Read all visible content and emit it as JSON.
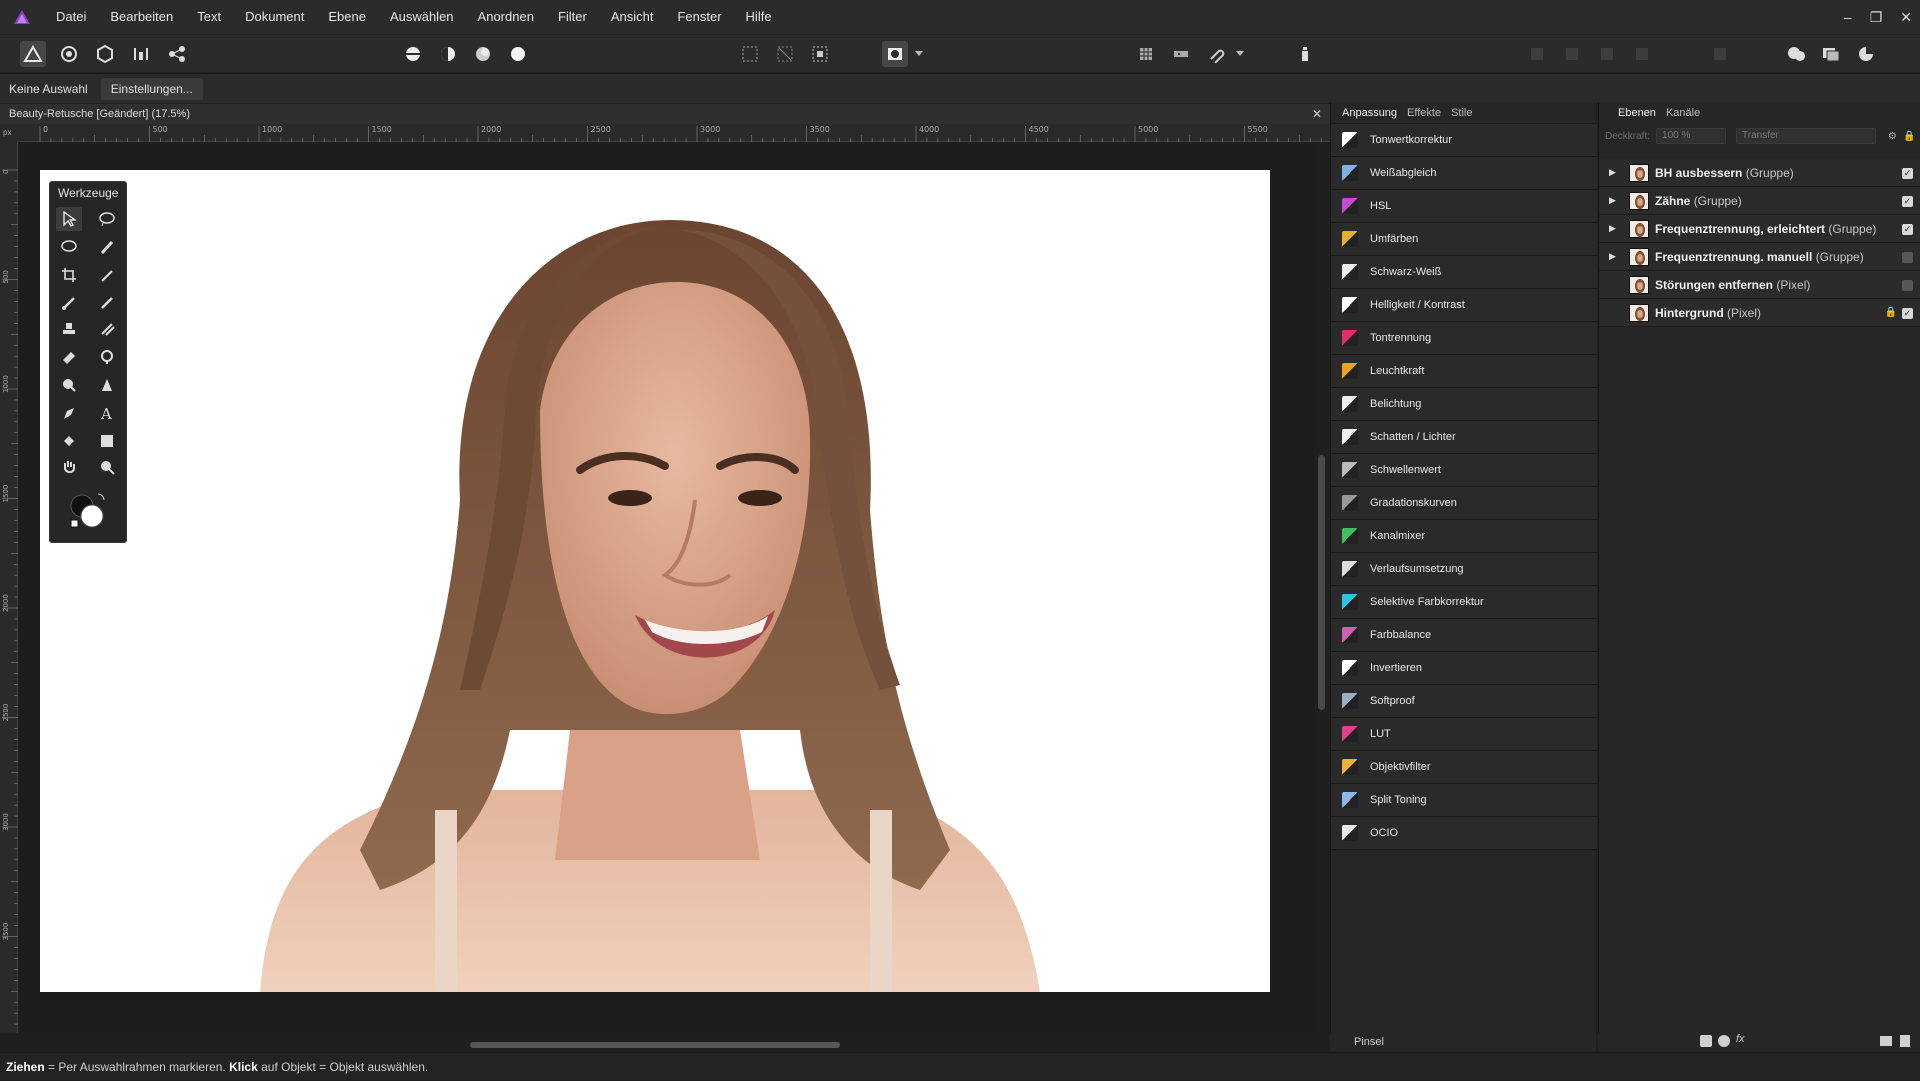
{
  "app": {
    "logo_icon": "affinity-photo-logo",
    "accent": "#8a3fd1"
  },
  "menu": [
    "Datei",
    "Bearbeiten",
    "Text",
    "Dokument",
    "Ebene",
    "Auswählen",
    "Anordnen",
    "Filter",
    "Ansicht",
    "Fenster",
    "Hilfe"
  ],
  "window_controls": {
    "minimize": "–",
    "restore": "❐",
    "close": "✕"
  },
  "context": {
    "selection": "Keine Auswahl",
    "settings_button": "Einstellungen..."
  },
  "document": {
    "tab_title": "Beauty-Retusche [Geändert] (17.5%)",
    "close": "✕",
    "zoom_percent": 17.5
  },
  "ruler": {
    "unit": "px",
    "h_labels": [
      "0",
      "500",
      "1000",
      "1500",
      "2000",
      "2500",
      "3000",
      "3500",
      "4000",
      "4500",
      "5000",
      "5500"
    ],
    "v_labels": [
      "0",
      "500",
      "1000",
      "1500",
      "2000",
      "2500",
      "3000",
      "3500"
    ]
  },
  "tools_panel": {
    "title": "Werkzeuge"
  },
  "adjust_panel": {
    "tabs": [
      "Anpassung",
      "Effekte",
      "Stile"
    ],
    "items": [
      {
        "label": "Tonwertkorrektur",
        "color": "#ffffff"
      },
      {
        "label": "Weißabgleich",
        "color": "#7fb0e0"
      },
      {
        "label": "HSL",
        "color": "#c84ad0"
      },
      {
        "label": "Umfärben",
        "color": "#e0b030"
      },
      {
        "label": "Schwarz-Weiß",
        "color": "#f0f0f0"
      },
      {
        "label": "Helligkeit / Kontrast",
        "color": "#ffffff"
      },
      {
        "label": "Tontrennung",
        "color": "#e0306a"
      },
      {
        "label": "Leuchtkraft",
        "color": "#f0a020"
      },
      {
        "label": "Belichtung",
        "color": "#f0f0f0"
      },
      {
        "label": "Schatten / Lichter",
        "color": "#f0f0f0"
      },
      {
        "label": "Schwellenwert",
        "color": "#bbbbbb"
      },
      {
        "label": "Gradationskurven",
        "color": "#999999"
      },
      {
        "label": "Kanalmixer",
        "color": "#40c060"
      },
      {
        "label": "Verlaufsumsetzung",
        "color": "#dddddd"
      },
      {
        "label": "Selektive Farbkorrektur",
        "color": "#30c0e0"
      },
      {
        "label": "Farbbalance",
        "color": "#d060b0"
      },
      {
        "label": "Invertieren",
        "color": "#ffffff"
      },
      {
        "label": "Softproof",
        "color": "#9ab0c8"
      },
      {
        "label": "LUT",
        "color": "#e04090"
      },
      {
        "label": "Objektivfilter",
        "color": "#f0b040"
      },
      {
        "label": "Split Toning",
        "color": "#8fb8e8"
      },
      {
        "label": "OCIO",
        "color": "#e8e8e8"
      }
    ],
    "brush_label": "Pinsel"
  },
  "layers_panel": {
    "tabs": [
      "Ebenen",
      "Kanäle"
    ],
    "opacity_label": "Deckkraft:",
    "opacity": "100 %",
    "blend": "Transfer",
    "layers": [
      {
        "name": "BH ausbessern",
        "type": "(Gruppe)",
        "expander": "▶",
        "visible": true,
        "locked": false
      },
      {
        "name": "Zähne",
        "type": "(Gruppe)",
        "expander": "▶",
        "visible": true,
        "locked": false
      },
      {
        "name": "Frequenztrennung, erleichtert",
        "type": "(Gruppe)",
        "expander": "▶",
        "visible": true,
        "locked": false
      },
      {
        "name": "Frequenztrennung. manuell",
        "type": "(Gruppe)",
        "expander": "▶",
        "visible": false,
        "locked": false
      },
      {
        "name": "Störungen entfernen",
        "type": "(Pixel)",
        "expander": "",
        "visible": false,
        "locked": false
      },
      {
        "name": "Hintergrund",
        "type": "(Pixel)",
        "expander": "",
        "visible": true,
        "locked": true
      }
    ]
  },
  "status": {
    "bold1": "Ziehen",
    "text1": " = Per Auswahlrahmen markieren. ",
    "bold2": "Klick",
    "text2": " auf Objekt = Objekt auswählen."
  }
}
